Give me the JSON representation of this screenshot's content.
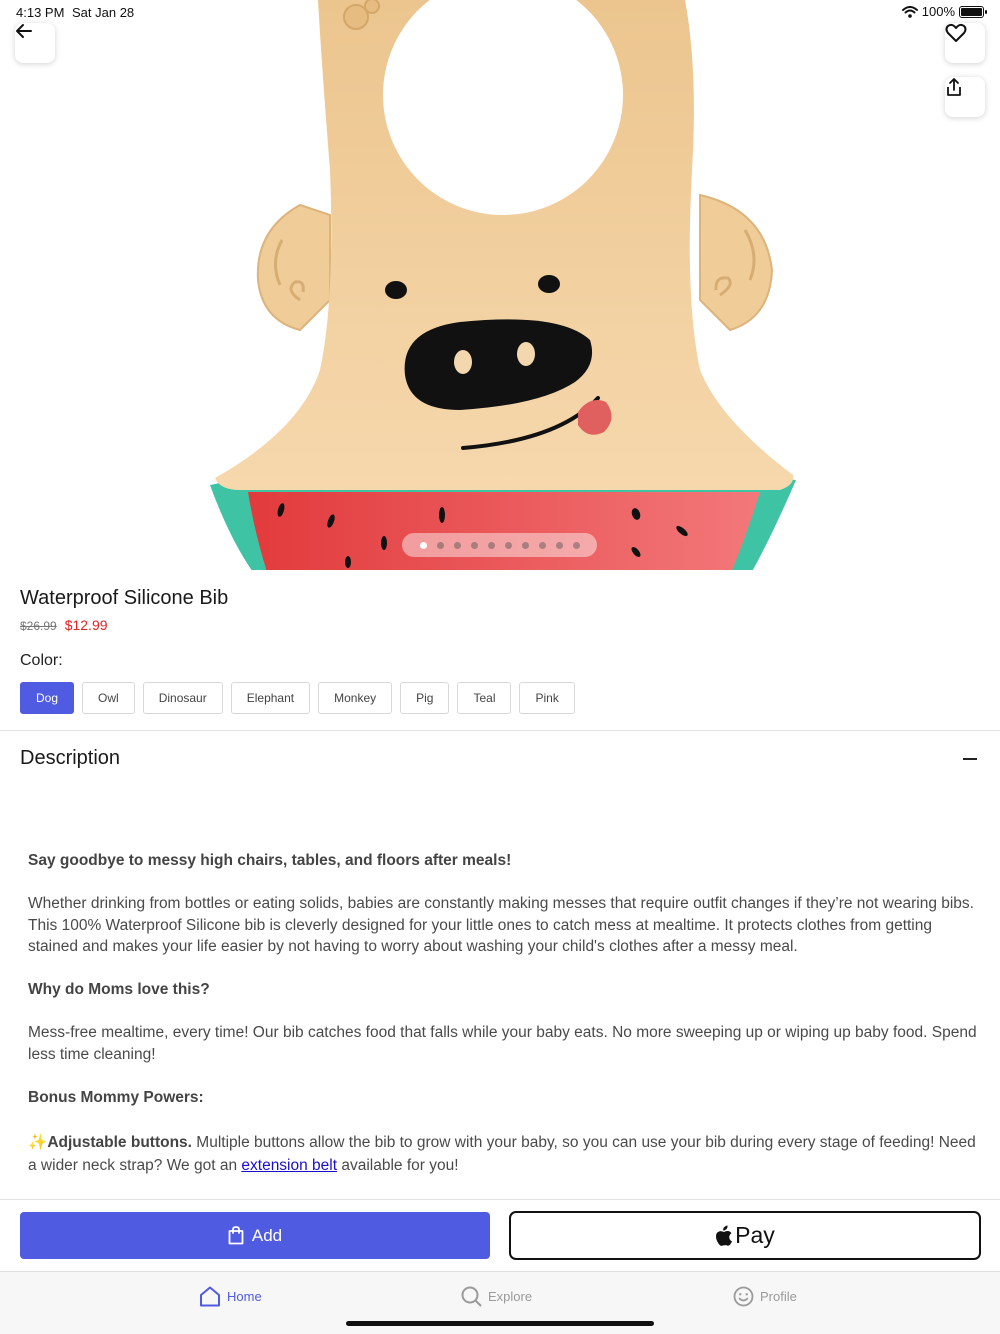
{
  "status_bar": {
    "time": "4:13 PM",
    "date": "Sat Jan 28",
    "battery": "100%"
  },
  "carousel": {
    "image_count": 10,
    "active_index": 0
  },
  "product": {
    "title": "Waterproof Silicone Bib",
    "original_price": "$26.99",
    "sale_price": "$12.99",
    "color_label": "Color:",
    "colors": [
      "Dog",
      "Owl",
      "Dinosaur",
      "Elephant",
      "Monkey",
      "Pig",
      "Teal",
      "Pink"
    ],
    "selected_color": "Dog"
  },
  "description": {
    "heading": "Description",
    "headline": "Say goodbye to messy high chairs, tables, and floors after meals!",
    "paragraph1": "Whether drinking from bottles or eating solids, babies are constantly making messes that require outfit changes if they’re not wearing bibs. This 100% Waterproof Silicone bib is cleverly designed for your little ones to catch mess at mealtime. It protects clothes from getting stained and makes your life easier by not having to worry about washing your child's clothes after a messy meal.",
    "subheading1": "Why do Moms love this?",
    "paragraph2": "Mess-free mealtime, every time! Our bib catches food that falls while your baby eats. No more sweeping up or wiping up baby food. Spend less time cleaning!",
    "subheading2": "Bonus Mommy Powers:",
    "sparkle": "✨",
    "feature_title": "Adjustable buttons.",
    "feature_text": " Multiple buttons allow the bib to grow with your baby, so you can use your bib during every stage of feeding! Need a wider neck strap? We got an ",
    "link_text": "extension belt",
    "feature_end": " available for you!"
  },
  "actions": {
    "add_label": "Add",
    "pay_label": "Pay"
  },
  "tabs": [
    {
      "label": "Home",
      "icon": "home-icon",
      "active": true
    },
    {
      "label": "Explore",
      "icon": "search-icon",
      "active": false
    },
    {
      "label": "Profile",
      "icon": "smiley-icon",
      "active": false
    }
  ],
  "colors": {
    "accent": "#4f5be0",
    "sale": "#e02424",
    "bib": "#f1cfa0",
    "watermelon": "#e9484a",
    "rind": "#3ec4a4"
  }
}
